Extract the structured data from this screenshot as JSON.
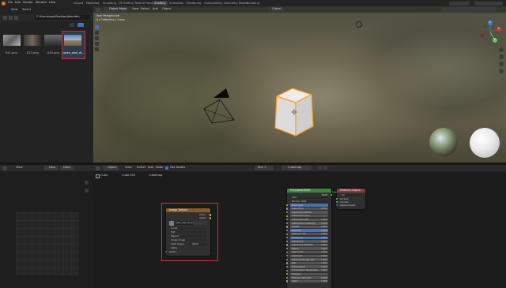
{
  "menubar": {
    "items": [
      "File",
      "Edit",
      "Render",
      "Window",
      "Help"
    ],
    "workspaces": [
      "Layout",
      "Modeling",
      "Sculpting",
      "UV Editing",
      "Texture Paint",
      "Shading",
      "Animation",
      "Rendering",
      "Compositing",
      "Geometry Nodes",
      "Scripting"
    ],
    "active_workspace": "Shading"
  },
  "file_browser": {
    "header_items": [
      "View",
      "Select"
    ],
    "path": "C:\\Users\\egs\\Desktop\\blender\\",
    "files": [
      {
        "name": "041.png"
      },
      {
        "name": "022.png"
      },
      {
        "name": "030.png"
      },
      {
        "name": "open_wall_di..."
      }
    ],
    "selected_index": 3
  },
  "viewport": {
    "mode": "Object Mode",
    "menus": [
      "View",
      "Select",
      "Add",
      "Object"
    ],
    "transform": "Global",
    "overlay_title": "User Perspective",
    "overlay_subtitle": "(1) Collection | Cube",
    "gizmo_axes": [
      "X",
      "Y",
      "Z"
    ]
  },
  "image_editor": {
    "menus": [
      "View",
      "Image"
    ],
    "new_label": "New",
    "open_label": "Open"
  },
  "node_editor": {
    "object_label": "Object",
    "menus": [
      "View",
      "Select",
      "Add",
      "Node"
    ],
    "use_nodes_label": "Use Nodes",
    "slot_label": "Slot 1",
    "material_name": "Cubemap",
    "breadcrumb": [
      "Cube",
      "Cube.001",
      "Cubemap"
    ],
    "image_node": {
      "title": "Image Texture",
      "outputs": [
        "Color",
        "Alpha"
      ],
      "image_name": "open_wall_di.png",
      "rows": [
        "Linear",
        "Flat",
        "Repeat",
        "Single Image",
        "Color Space",
        "Alpha"
      ],
      "color_space_value": "sRGB",
      "vector_label": "Vector"
    },
    "bsdf_node": {
      "title": "Principled BSDF",
      "output": "BSDF",
      "rows": [
        "GGX",
        "Random Walk",
        "Base Color",
        "Subsurface",
        "Subsurface Radius",
        "Subsurface Color",
        "Subsurface IOR",
        "Subsurface Anisotropy",
        "Metallic",
        "Specular",
        "Specular Tint",
        "Roughness",
        "Anisotropic",
        "Anisotropic Rotation",
        "Sheen",
        "Sheen Tint",
        "Clearcoat",
        "Clearcoat Roughness",
        "IOR",
        "Transmission",
        "Transmission Roughness",
        "Emission",
        "Emission Strength",
        "Alpha"
      ],
      "values": [
        "",
        "",
        "",
        "0.000",
        "",
        "",
        "1.400",
        "0.000",
        "0.000",
        "0.500",
        "0.000",
        "0.500",
        "0.000",
        "0.000",
        "0.000",
        "0.500",
        "0.000",
        "0.030",
        "1.450",
        "0.000",
        "0.000",
        "",
        "1.000",
        "1.000"
      ]
    },
    "output_node": {
      "title": "Material Output",
      "target": "All",
      "inputs": [
        "Surface",
        "Volume",
        "Displacement"
      ]
    }
  },
  "colors": {
    "accent_selection": "#d13030",
    "bsdf_header": "#3b8a3b",
    "output_header": "#8a3b3b",
    "texture_header": "#8a5a2b",
    "selected_row": "#4772b3",
    "socket_yellow": "#c7c729",
    "socket_green": "#63c763",
    "socket_grey": "#a1a1a1",
    "socket_purple": "#6363c7"
  },
  "icons": [
    "blender-logo-icon",
    "camera-icon",
    "light-icon",
    "cube-icon",
    "hand-icon",
    "zoom-icon",
    "shading-sphere-icon"
  ]
}
